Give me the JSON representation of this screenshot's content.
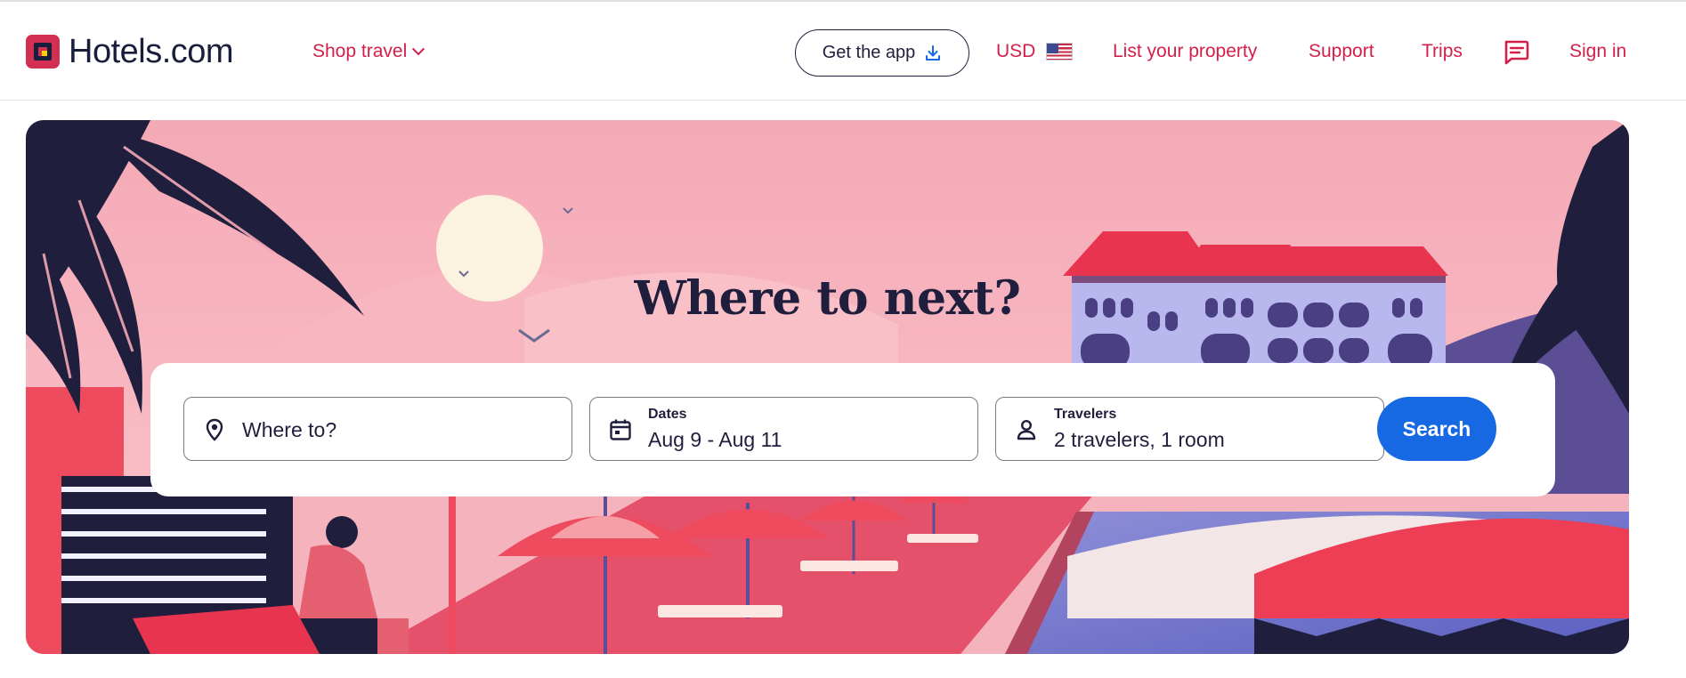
{
  "brand": {
    "name": "Hotels.com",
    "color": "#d32f52"
  },
  "header": {
    "shop_travel": "Shop travel",
    "get_app": "Get the app",
    "currency": "USD",
    "list_property": "List your property",
    "support": "Support",
    "trips": "Trips",
    "sign_in": "Sign in",
    "icons": [
      "chevron-down-icon",
      "download-icon",
      "us-flag-icon",
      "message-icon"
    ]
  },
  "hero": {
    "title": "Where to next?"
  },
  "search": {
    "destination": {
      "placeholder": "Where to?",
      "icon": "location-pin-icon"
    },
    "dates": {
      "label": "Dates",
      "value": "Aug 9 - Aug 11",
      "icon": "calendar-icon"
    },
    "travelers": {
      "label": "Travelers",
      "value": "2 travelers, 1 room",
      "icon": "person-icon"
    },
    "button": "Search"
  },
  "colors": {
    "accent": "#d41f4a",
    "primary_button": "#1668e3",
    "text": "#1f1f3d"
  }
}
